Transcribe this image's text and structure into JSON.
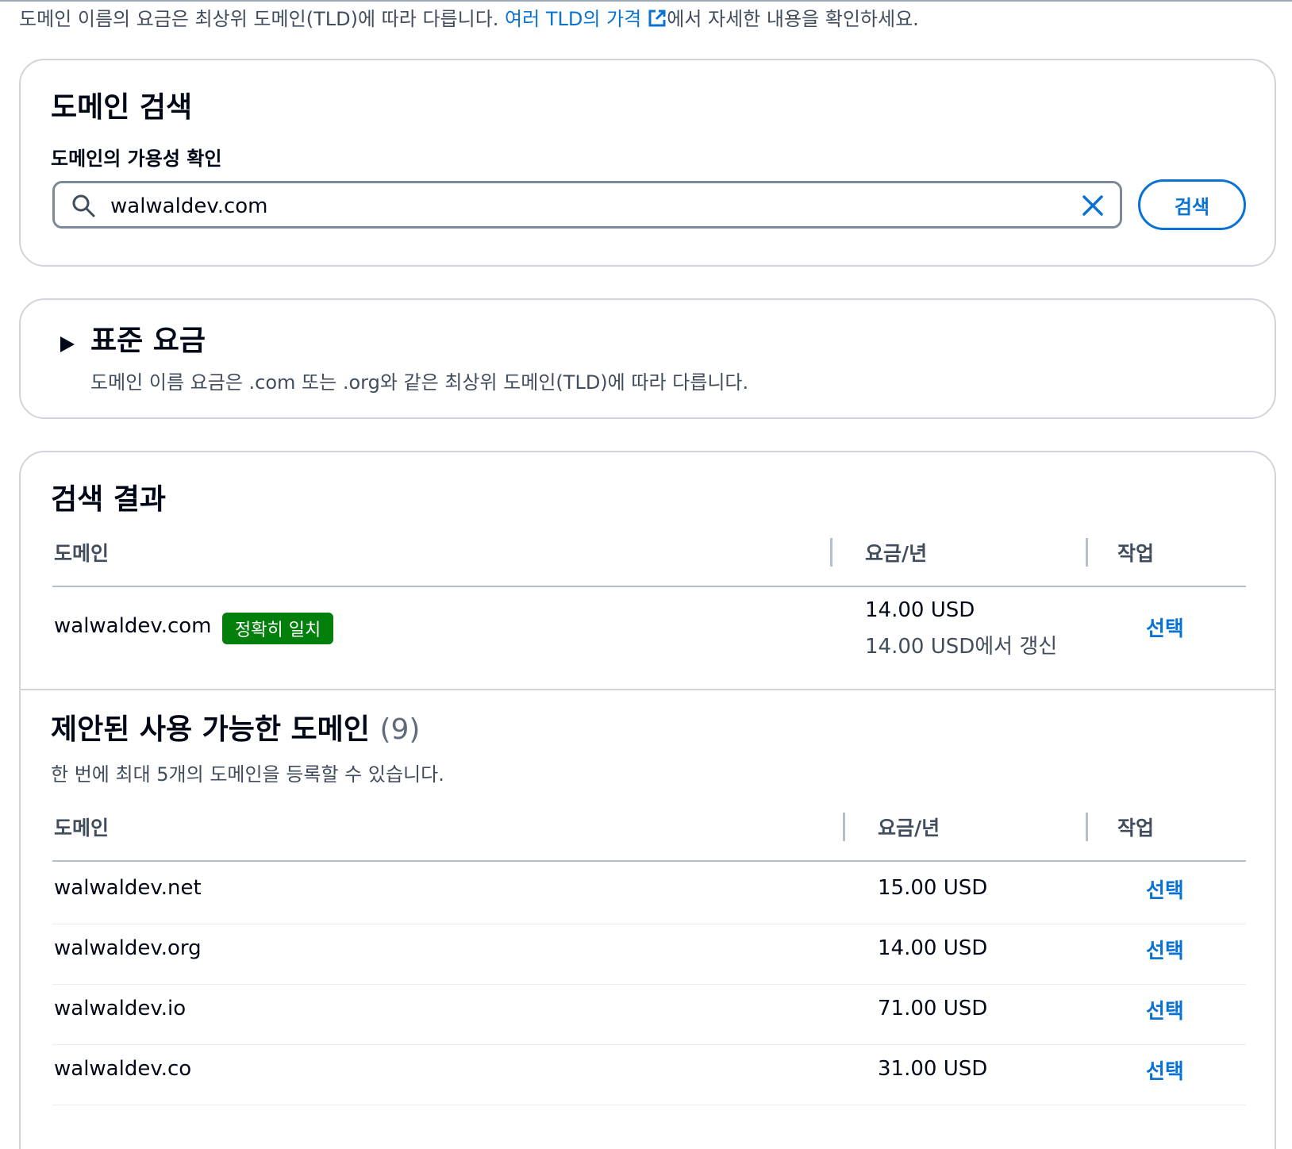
{
  "intro": {
    "text_before": "도메인 이름의 요금은 최상위 도메인(TLD)에 따라 다릅니다.",
    "link_text": "여러 TLD의 가격",
    "text_after": "에서 자세한 내용을 확인하세요."
  },
  "domain_search": {
    "title": "도메인 검색",
    "field_label": "도메인의 가용성 확인",
    "search_value": "walwaldev.com",
    "search_button": "검색"
  },
  "standard_pricing": {
    "title": "표준 요금",
    "description": "도메인 이름 요금은 .com 또는 .org와 같은 최상위 도메인(TLD)에 따라 다릅니다."
  },
  "search_results": {
    "title": "검색 결과",
    "columns": {
      "domain": "도메인",
      "price": "요금/년",
      "action": "작업"
    },
    "exact": {
      "domain": "walwaldev.com",
      "badge": "정확히 일치",
      "price": "14.00 USD",
      "renewal": "14.00 USD에서 갱신",
      "action": "선택"
    }
  },
  "suggestions": {
    "title": "제안된 사용 가능한 도메인",
    "count": "(9)",
    "description": "한 번에 최대 5개의 도메인을 등록할 수 있습니다.",
    "columns": {
      "domain": "도메인",
      "price": "요금/년",
      "action": "작업"
    },
    "rows": [
      {
        "domain": "walwaldev.net",
        "price": "15.00 USD",
        "action": "선택"
      },
      {
        "domain": "walwaldev.org",
        "price": "14.00 USD",
        "action": "선택"
      },
      {
        "domain": "walwaldev.io",
        "price": "71.00 USD",
        "action": "선택"
      },
      {
        "domain": "walwaldev.co",
        "price": "31.00 USD",
        "action": "선택"
      }
    ]
  },
  "colors": {
    "link": "#0972d3",
    "badge_success": "#037f0c",
    "text": "#000716",
    "muted": "#414d5c"
  }
}
